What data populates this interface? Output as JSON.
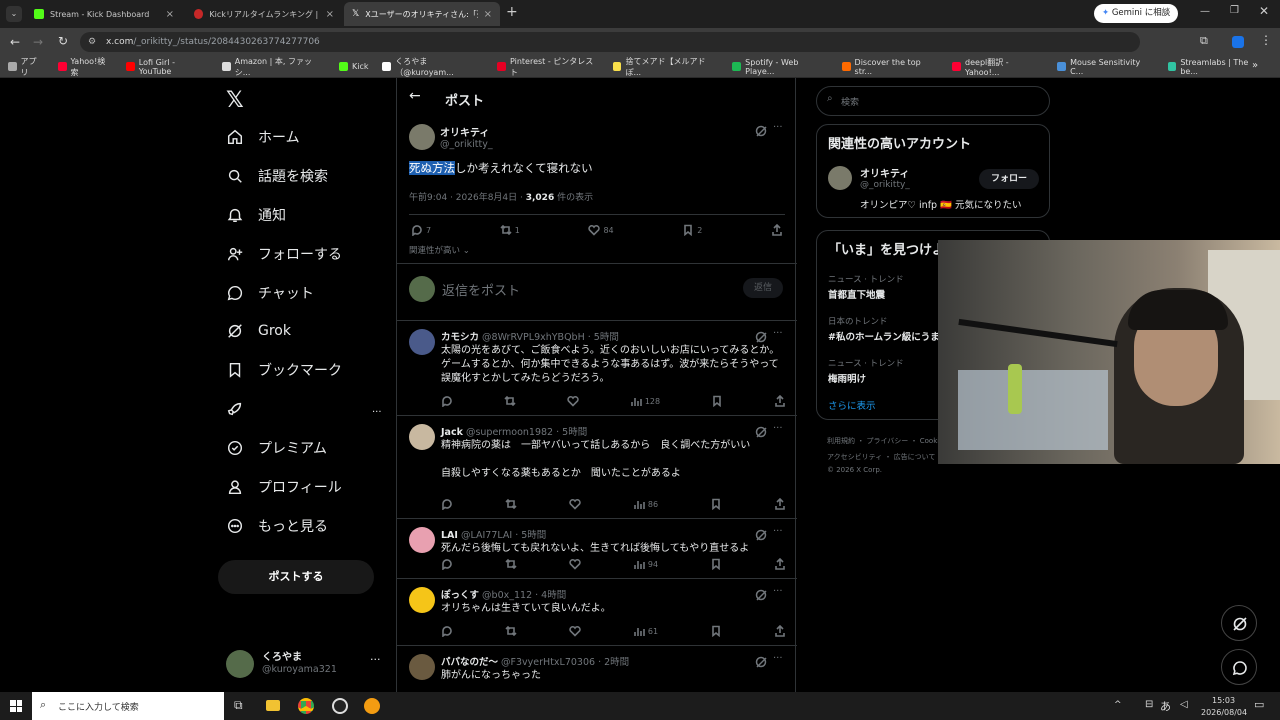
{
  "browser": {
    "tabs": [
      {
        "title": "Stream - Kick Dashboard",
        "color": "#53fc18"
      },
      {
        "title": "Kickリアルタイムランキング | 配信者",
        "color": "#c62828"
      },
      {
        "title": "Xユーザーのオリキティさん:「死ぬ方法",
        "color": "#ffffff"
      }
    ],
    "new_tab": "+",
    "gemini_label": "Gemini に相談",
    "url_host": "x.com",
    "url_path": "/_orikitty_/status/2084430263774277706",
    "bookmarks": [
      {
        "label": "アプリ",
        "color": "#aaaaaa"
      },
      {
        "label": "Yahoo!検索",
        "color": "#ff0033"
      },
      {
        "label": "Lofi Girl - YouTube",
        "color": "#ff0000"
      },
      {
        "label": "Amazon | 本, ファッシ...",
        "color": "#dddddd"
      },
      {
        "label": "Kick",
        "color": "#53fc18"
      },
      {
        "label": "くろやま（@kuroyam...",
        "color": "#ffffff"
      },
      {
        "label": "Pinterest - ピンタレスト",
        "color": "#e60023"
      },
      {
        "label": "捨てメアド【メルアドぽ...",
        "color": "#f9e04b"
      },
      {
        "label": "Spotify - Web Playe...",
        "color": "#1db954"
      },
      {
        "label": "Discover the top str...",
        "color": "#ff6a00"
      },
      {
        "label": "deepl翻訳 - Yahoo!...",
        "color": "#ff0033"
      },
      {
        "label": "Mouse Sensitivity C...",
        "color": "#4a90d9"
      },
      {
        "label": "Streamlabs | The be...",
        "color": "#31c3a2"
      }
    ],
    "more_bookmarks": "»"
  },
  "nav": {
    "items": [
      {
        "label": "ホーム",
        "icon": "home-icon"
      },
      {
        "label": "話題を検索",
        "icon": "search-icon"
      },
      {
        "label": "通知",
        "icon": "bell-icon"
      },
      {
        "label": "フォローする",
        "icon": "person-add-icon"
      },
      {
        "label": "チャット",
        "icon": "chat-icon"
      },
      {
        "label": "Grok",
        "icon": "grok-icon"
      },
      {
        "label": "ブックマーク",
        "icon": "bookmark-icon"
      },
      {
        "label": "",
        "icon": "rocket-icon"
      },
      {
        "label": "プレミアム",
        "icon": "verified-icon"
      },
      {
        "label": "プロフィール",
        "icon": "profile-icon"
      },
      {
        "label": "もっと見る",
        "icon": "more-circle-icon"
      }
    ],
    "more_dots": "...",
    "post_button": "ポストする",
    "account": {
      "name": "くろやま",
      "handle": "@kuroyama321"
    }
  },
  "post_header": {
    "back": "←",
    "title": "ポスト"
  },
  "post": {
    "name": "オリキティ",
    "handle": "@_orikitty_",
    "text_highlight": "死ぬ方法",
    "text_rest": "しか考えれなくて寝れない",
    "time": "午前9:04 · 2026年8月4日 · ",
    "views": "3,026",
    "views_suffix": " 件の表示",
    "replies": "7",
    "reposts": "1",
    "likes": "84",
    "bookmarks": "2",
    "sort": "関連性が高い",
    "reply_placeholder": "返信をポスト",
    "reply_button": "返信"
  },
  "replies": [
    {
      "name": "カモシカ",
      "meta": "@8WrRVPL9xhYBQbH · 5時間",
      "lines": [
        "太陽の光をあびて、ご飯食べよう。近くのおいしいお店にいってみるとか。",
        "ゲームするとか、何か集中できるような事あるはず。波が来たらそうやって",
        "誤魔化すとかしてみたらどうだろう。"
      ],
      "views": "128",
      "avatar": "#4a5a8a"
    },
    {
      "name": "Jack",
      "meta": "@supermoon1982 · 5時間",
      "lines": [
        "精神病院の薬は　一部ヤバいって話しあるから　良く調べた方がいい",
        "",
        "自殺しやすくなる薬もあるとか　聞いたことがあるよ"
      ],
      "views": "86",
      "avatar": "#c8b8a0"
    },
    {
      "name": "LAI",
      "meta": "@LAI77LAI · 5時間",
      "lines": [
        "死んだら後悔しても戻れないよ、生きてれば後悔してもやり直せるよ"
      ],
      "views": "94",
      "avatar": "#e8a0b0"
    },
    {
      "name": "ぽっくす",
      "meta": "@b0x_112 · 4時間",
      "lines": [
        "オリちゃんは生きていて良いんだよ。"
      ],
      "views": "61",
      "avatar": "#f5c518"
    },
    {
      "name": "パパなのだ〜",
      "meta": "@F3vyerHtxL70306 · 2時間",
      "lines": [
        "肺がんになっちゃった"
      ],
      "views": "",
      "avatar": "#6a5a40"
    }
  ],
  "right": {
    "search_placeholder": "検索",
    "related_title": "関連性の高いアカウント",
    "related": {
      "name": "オリキティ",
      "handle": "@_orikitty_",
      "follow": "フォロー",
      "bio": "オリンピア♡ infp 🇪🇸 元気になりたい"
    },
    "trends_title": "「いま」を見つけよう",
    "trends": [
      {
        "category": "ニュース · トレンド",
        "name": "首都直下地震"
      },
      {
        "category": "日本のトレンド",
        "name": "#私のホームラン級にうま"
      },
      {
        "category": "ニュース · トレンド",
        "name": "梅雨明け"
      }
    ],
    "show_more": "さらに表示",
    "footer1": "利用規約 ・ プライバシー ・ Cookie",
    "footer2": "アクセシビリティ ・ 広告について",
    "footer3": "© 2026 X Corp."
  },
  "taskbar": {
    "search_placeholder": "ここに入力して検索",
    "time": "15:03",
    "date": "2026/08/04",
    "ime": "あ"
  }
}
